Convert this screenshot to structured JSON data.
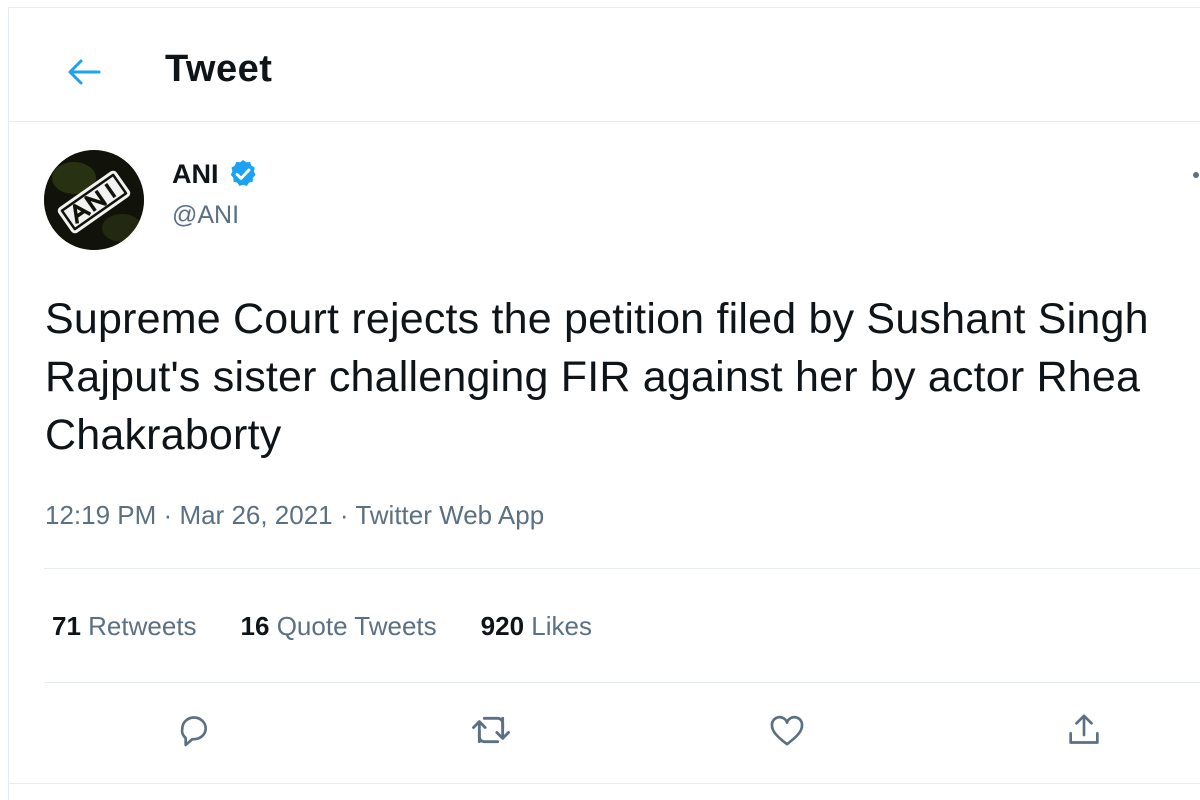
{
  "header": {
    "back_icon": "back-arrow-icon",
    "title": "Tweet"
  },
  "author": {
    "name": "ANI",
    "handle": "@ANI",
    "verified": true,
    "verified_icon": "verified-badge-icon",
    "avatar_icon": "ani-logo-avatar"
  },
  "tweet": {
    "text": "Supreme Court rejects the petition filed by Sushant Singh Rajput's sister challenging FIR against her by actor Rhea Chakraborty",
    "time": "12:19 PM",
    "date": "Mar 26, 2021",
    "source": "Twitter Web App",
    "separator": "·"
  },
  "stats": {
    "retweets_count": "71",
    "retweets_label": "Retweets",
    "quotes_count": "16",
    "quotes_label": "Quote Tweets",
    "likes_count": "920",
    "likes_label": "Likes"
  },
  "actions": [
    "reply-icon",
    "retweet-icon",
    "like-icon",
    "share-icon"
  ],
  "colors": {
    "accent": "#1da1f2",
    "text_primary": "#0f1419",
    "text_secondary": "#5b7083",
    "divider": "#e6ecf0"
  }
}
